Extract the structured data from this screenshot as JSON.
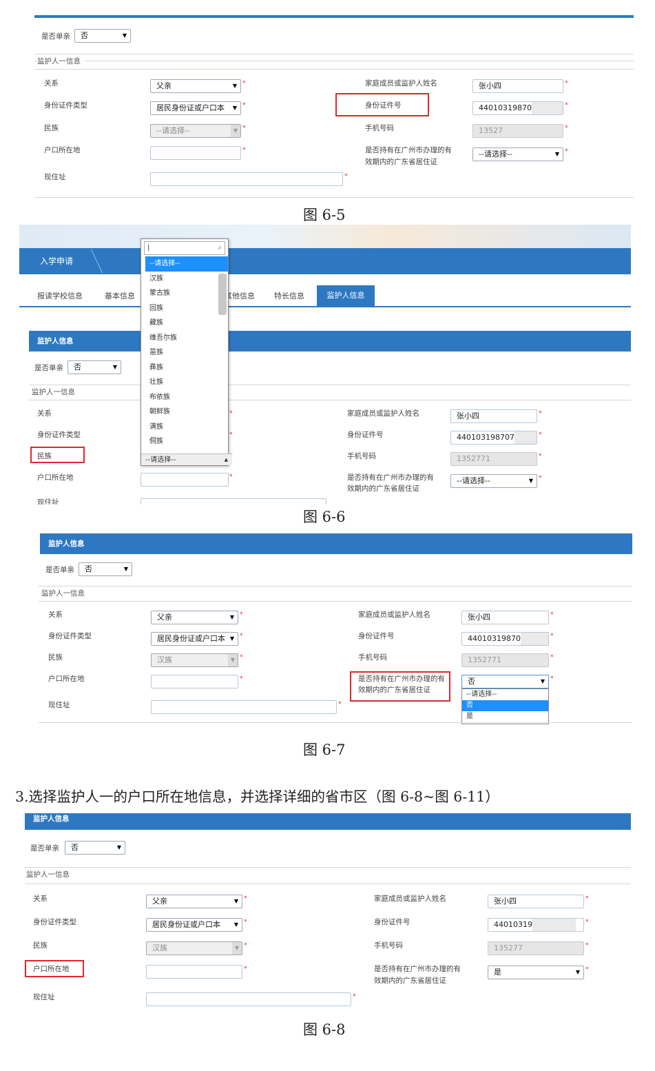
{
  "fig5": {
    "caption": "图 6-5",
    "single_parent_label": "是否单亲",
    "single_parent_value": "否",
    "section_label": "监护人一信息",
    "relation_label": "关系",
    "relation_value": "父亲",
    "idtype_label": "身份证件类型",
    "idtype_value": "居民身份证或户口本",
    "ethnic_label": "民族",
    "ethnic_value": "--请选择--",
    "hukou_label": "户口所在地",
    "address_label": "现住址",
    "name_label": "家庭成员或监护人姓名",
    "name_value": "张小四",
    "idno_label": "身份证件号",
    "idno_value": "44010319870",
    "phone_label": "手机号码",
    "phone_value": "13527",
    "permit_label_1": "是否持有在广州市办理的有",
    "permit_label_2": "效期内的广东省居住证",
    "permit_value": "--请选择--"
  },
  "fig6": {
    "caption": "图 6-6",
    "nav_title": "入学申请",
    "tabs": [
      "报读学校信息",
      "基本信息",
      "其他信息",
      "特长信息",
      "监护人信息"
    ],
    "panel_title": "监护人信息",
    "single_parent_label": "是否单亲",
    "single_parent_value": "否",
    "section_label": "监护人一信息",
    "relation_label": "关系",
    "idtype_label": "身份证件类型",
    "ethnic_label": "民族",
    "hukou_label": "户口所在地",
    "address_label": "现住址",
    "name_label": "家庭成员或监护人姓名",
    "name_value": "张小四",
    "idno_label": "身份证件号",
    "idno_value": "440103198707",
    "phone_label": "手机号码",
    "phone_value": "1352771",
    "permit_label_1": "是否持有在广州市办理的有",
    "permit_label_2": "效期内的广东省居住证",
    "permit_value": "--请选择--",
    "dropdown_options": [
      "--请选择--",
      "汉族",
      "蒙古族",
      "回族",
      "藏族",
      "维吾尔族",
      "苗族",
      "彝族",
      "壮族",
      "布依族",
      "朝鲜族",
      "满族",
      "侗族"
    ],
    "dropdown_selected": "--请选择--"
  },
  "fig7": {
    "caption": "图 6-7",
    "panel_title": "监护人信息",
    "single_parent_label": "是否单亲",
    "single_parent_value": "否",
    "section_label": "监护人一信息",
    "relation_label": "关系",
    "relation_value": "父亲",
    "idtype_label": "身份证件类型",
    "idtype_value": "居民身份证或户口本",
    "ethnic_label": "民族",
    "ethnic_value": "汉族",
    "hukou_label": "户口所在地",
    "address_label": "现住址",
    "name_label": "家庭成员或监护人姓名",
    "name_value": "张小四",
    "idno_label": "身份证件号",
    "idno_value": "44010319870",
    "phone_label": "手机号码",
    "phone_value": "1352771",
    "permit_label_1": "是否持有在广州市办理的有",
    "permit_label_2": "效期内的广东省居住证",
    "permit_value": "否",
    "permit_options": [
      "--请选择--",
      "否",
      "是"
    ]
  },
  "instruction": "3.选择监护人一的户口所在地信息，并选择详细的省市区（图 6-8~图 6-11）",
  "fig8": {
    "caption": "图 6-8",
    "panel_title": "监护人信息",
    "single_parent_label": "是否单亲",
    "single_parent_value": "否",
    "section_label": "监护人一信息",
    "relation_label": "关系",
    "relation_value": "父亲",
    "idtype_label": "身份证件类型",
    "idtype_value": "居民身份证或户口本",
    "ethnic_label": "民族",
    "ethnic_value": "汉族",
    "hukou_label": "户口所在地",
    "address_label": "现住址",
    "name_label": "家庭成员或监护人姓名",
    "name_value": "张小四",
    "idno_label": "身份证件号",
    "idno_value": "44010319",
    "phone_label": "手机号码",
    "phone_value": "135277",
    "permit_label_1": "是否持有在广州市办理的有",
    "permit_label_2": "效期内的广东省居住证",
    "permit_value": "是"
  },
  "colors": {
    "brand_blue": "#2e78c2",
    "highlight_red": "#e0262b",
    "selection_blue": "#1e90ff"
  }
}
